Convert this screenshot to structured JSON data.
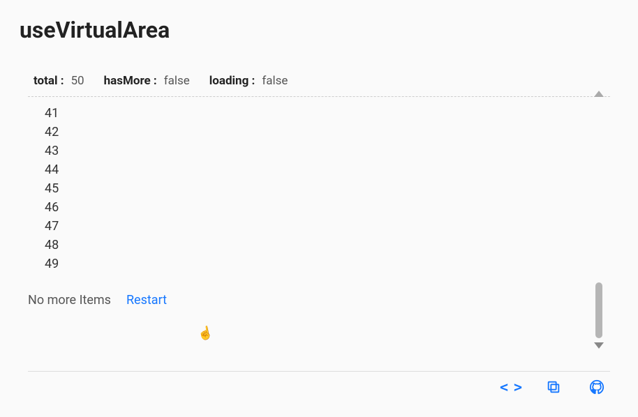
{
  "title": "useVirtualArea",
  "status": {
    "total_label": "total :",
    "total_value": "50",
    "hasMore_label": "hasMore :",
    "hasMore_value": "false",
    "loading_label": "loading :",
    "loading_value": "false"
  },
  "items": [
    "41",
    "42",
    "43",
    "44",
    "45",
    "46",
    "47",
    "48",
    "49"
  ],
  "footer": {
    "no_more_text": "No more Items",
    "restart_label": "Restart"
  },
  "actions": {
    "code_label": "< >",
    "copy_label": "copy",
    "github_label": "github"
  }
}
